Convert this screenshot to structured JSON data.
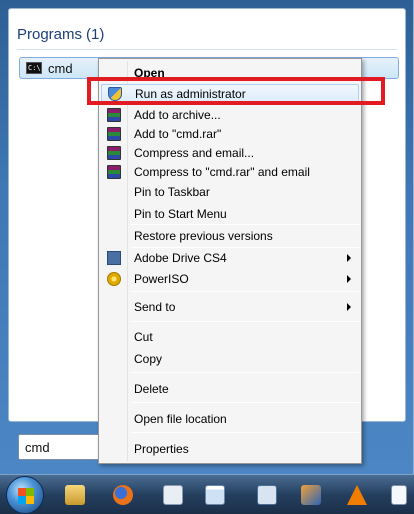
{
  "start_menu": {
    "group_title": "Programs",
    "group_count": "(1)",
    "result": {
      "label": "cmd"
    },
    "search": {
      "value": "cmd"
    }
  },
  "context_menu": {
    "items": [
      {
        "label": "Open",
        "bold": true
      },
      {
        "label": "Run as administrator",
        "icon": "uac-shield-icon"
      },
      {
        "label": "Add to archive...",
        "icon": "winrar-icon"
      },
      {
        "label": "Add to \"cmd.rar\"",
        "icon": "winrar-icon"
      },
      {
        "label": "Compress and email...",
        "icon": "winrar-icon"
      },
      {
        "label": "Compress to \"cmd.rar\" and email",
        "icon": "winrar-icon"
      },
      {
        "label": "Pin to Taskbar"
      },
      {
        "label": "Pin to Start Menu"
      },
      {
        "label": "Restore previous versions"
      },
      {
        "label": "Adobe Drive CS4",
        "icon": "adobe-drive-icon",
        "submenu": true
      },
      {
        "label": "PowerISO",
        "icon": "poweriso-icon",
        "submenu": true
      },
      {
        "label": "Send to",
        "submenu": true
      },
      {
        "label": "Cut"
      },
      {
        "label": "Copy"
      },
      {
        "label": "Delete"
      },
      {
        "label": "Open file location"
      },
      {
        "label": "Properties"
      }
    ]
  },
  "highlight_color": "#e21b23",
  "taskbar": {
    "icons": [
      "windows-explorer-icon",
      "firefox-icon",
      "paint-icon",
      "notepad-icon",
      "network-icon",
      "virtualbox-icon",
      "vlc-icon",
      "document-icon"
    ]
  }
}
